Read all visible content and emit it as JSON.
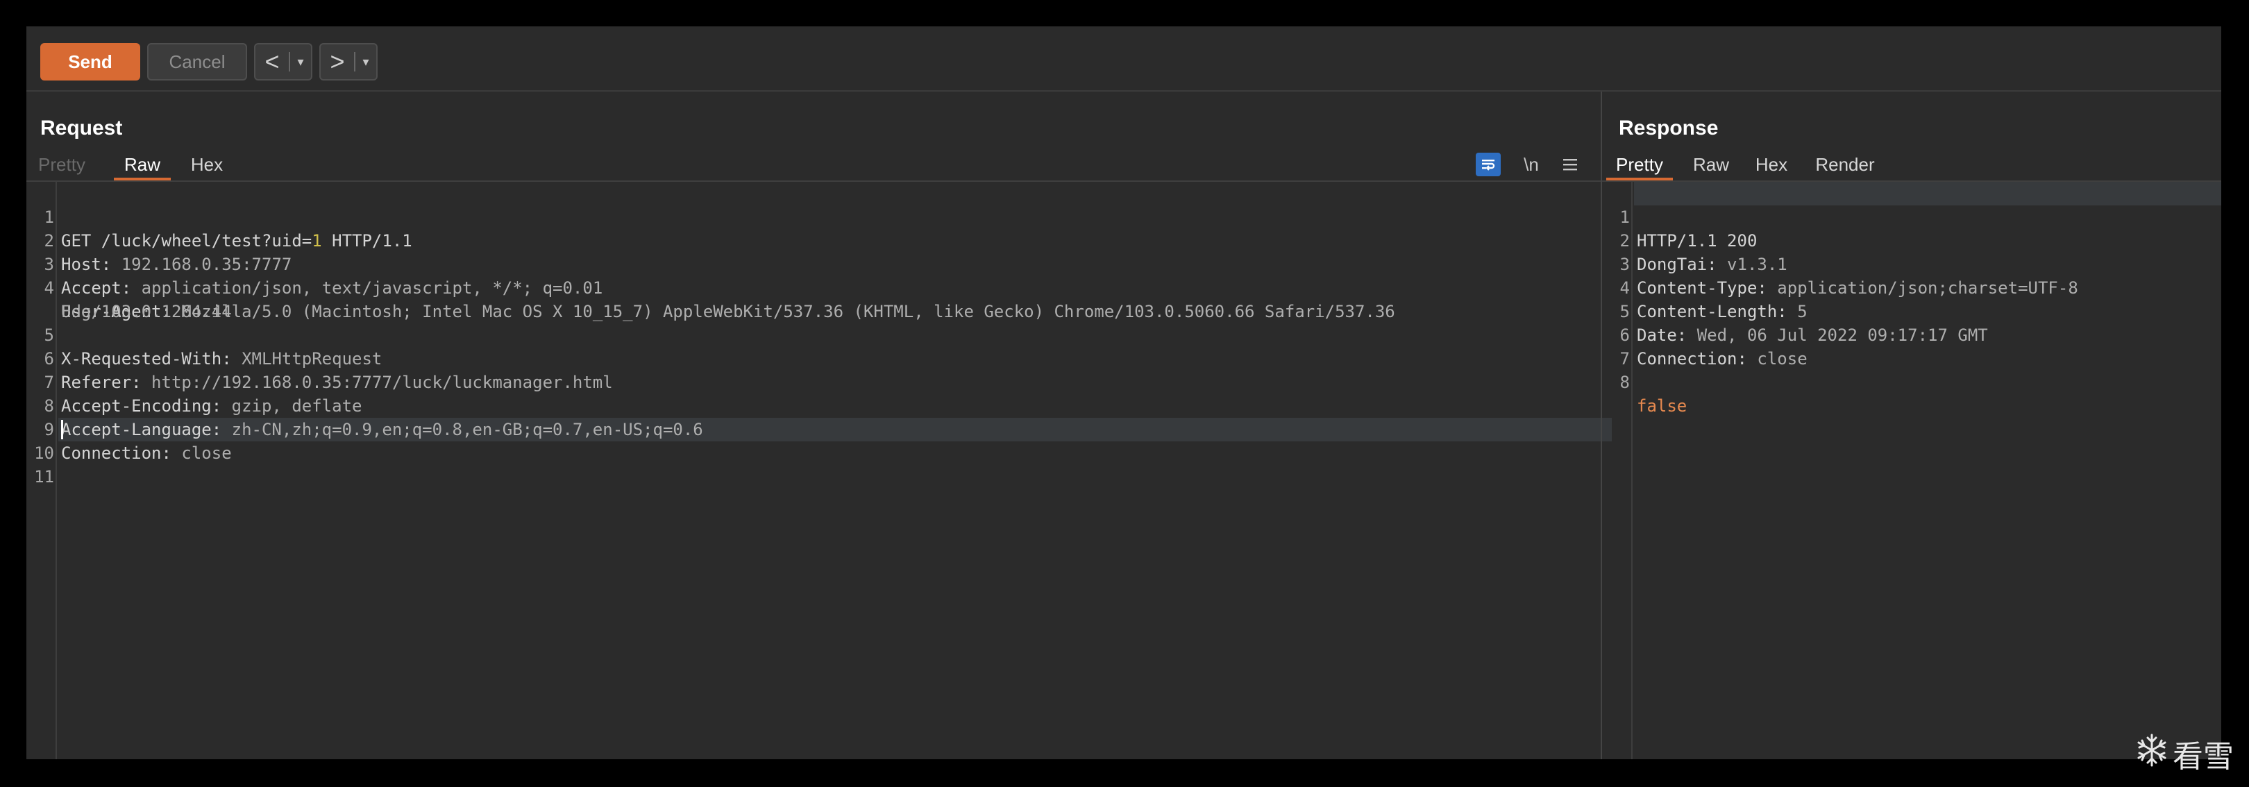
{
  "toolbar": {
    "send_label": "Send",
    "cancel_label": "Cancel",
    "back_glyph": "<",
    "forward_glyph": ">",
    "dropdown_glyph": "▾"
  },
  "request": {
    "title": "Request",
    "tabs": [
      {
        "label": "Pretty",
        "state": "disabled"
      },
      {
        "label": "Raw",
        "state": "active"
      },
      {
        "label": "Hex",
        "state": "normal"
      }
    ],
    "tools": {
      "wrap_icon": "word-wrap-icon",
      "newline_label": "\\n",
      "menu_icon": "hamburger-menu-icon"
    },
    "lines": [
      {
        "n": "1",
        "method": "GET /luck/wheel/test?uid=",
        "param": "1",
        "rest": " HTTP/1.1"
      },
      {
        "n": "2",
        "key": "Host:",
        "value": " 192.168.0.35:7777"
      },
      {
        "n": "3",
        "key": "Accept:",
        "value": " application/json, text/javascript, */*; q=0.01"
      },
      {
        "n": "4",
        "key": "User-Agent:",
        "value": " Mozilla/5.0 (Macintosh; Intel Mac OS X 10_15_7) AppleWebKit/537.36 (KHTML, like Gecko) Chrome/103.0.5060.66 Safari/537.36",
        "cont": "Edg/103.0.1264.44"
      },
      {
        "n": "5",
        "key": "X-Requested-With:",
        "value": " XMLHttpRequest"
      },
      {
        "n": "6",
        "key": "Referer:",
        "value": " http://192.168.0.35:7777/luck/luckmanager.html"
      },
      {
        "n": "7",
        "key": "Accept-Encoding:",
        "value": " gzip, deflate"
      },
      {
        "n": "8",
        "key": "Accept-Language:",
        "value": " zh-CN,zh;q=0.9,en;q=0.8,en-GB;q=0.7,en-US;q=0.6"
      },
      {
        "n": "9",
        "key": "Connection:",
        "value": " close"
      },
      {
        "n": "10"
      },
      {
        "n": "11"
      }
    ]
  },
  "response": {
    "title": "Response",
    "tabs": [
      {
        "label": "Pretty",
        "state": "active"
      },
      {
        "label": "Raw",
        "state": "normal"
      },
      {
        "label": "Hex",
        "state": "normal"
      },
      {
        "label": "Render",
        "state": "normal"
      }
    ],
    "lines": [
      {
        "n": "1",
        "status": "HTTP/1.1 200"
      },
      {
        "n": "2",
        "key": "DongTai:",
        "value": " v1.3.1"
      },
      {
        "n": "3",
        "key": "Content-Type:",
        "value": " application/json;charset=UTF-8"
      },
      {
        "n": "4",
        "key": "Content-Length:",
        "value": " 5"
      },
      {
        "n": "5",
        "key": "Date:",
        "value": " Wed, 06 Jul 2022 09:17:17 GMT"
      },
      {
        "n": "6",
        "key": "Connection:",
        "value": " close"
      },
      {
        "n": "7"
      },
      {
        "n": "8",
        "body": "false"
      }
    ]
  },
  "watermark": {
    "icon": "snowflake-logo-icon",
    "text": "看雪"
  },
  "colors": {
    "accent": "#d86a33",
    "background": "#2b2b2b",
    "param": "#d1c04a",
    "body_literal": "#e6894f"
  }
}
